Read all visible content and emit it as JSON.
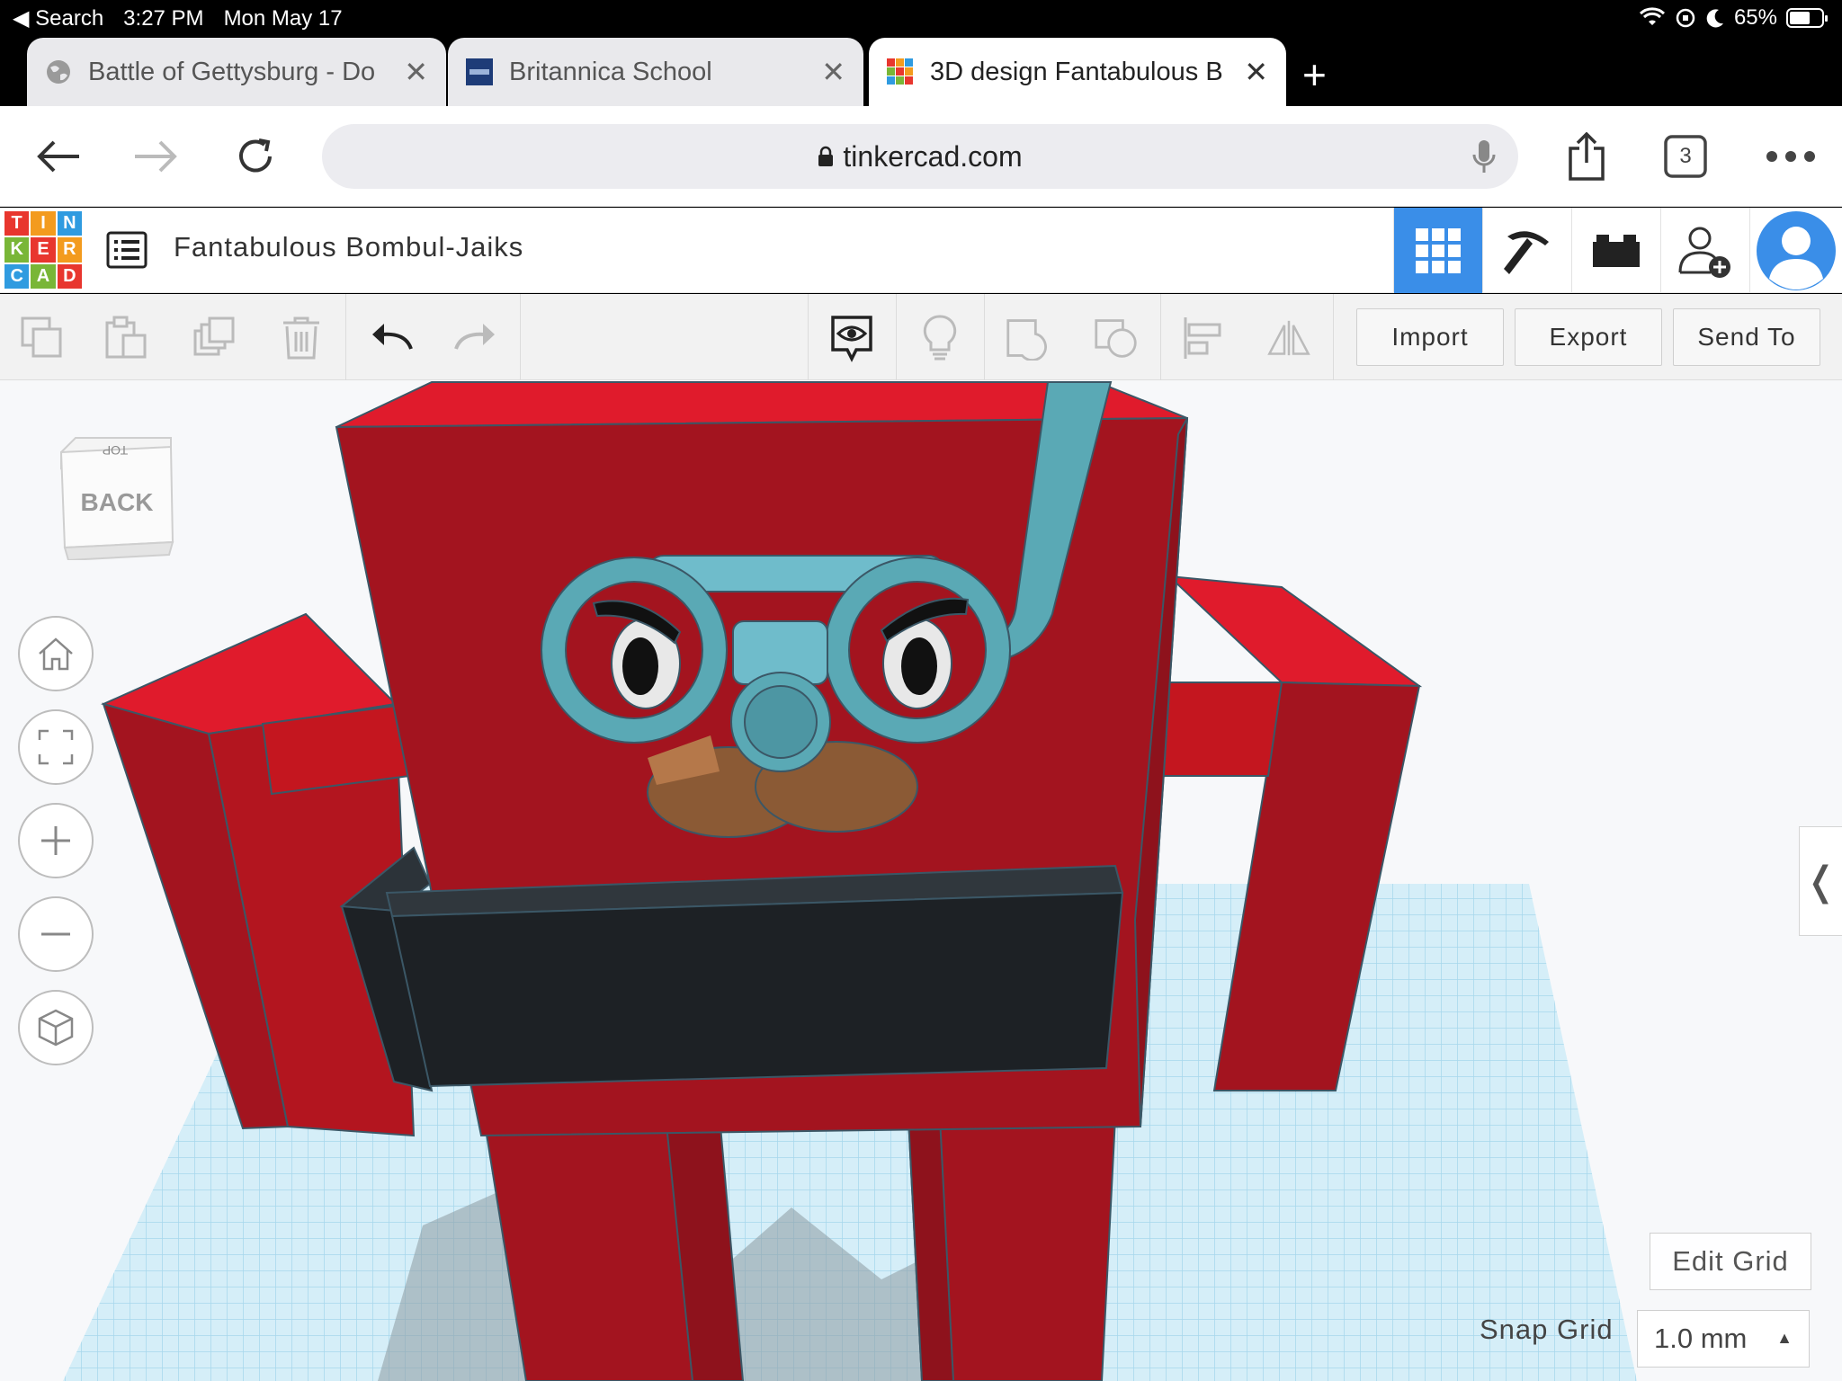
{
  "status_bar": {
    "back_app": "Search",
    "time": "3:27 PM",
    "date": "Mon May 17",
    "battery": "65%",
    "battery_level": 0.65
  },
  "browser": {
    "tabs": [
      {
        "title": "Battle of Gettysburg - Do",
        "active": false
      },
      {
        "title": "Britannica School",
        "active": false
      },
      {
        "title": "3D design Fantabulous B",
        "active": true
      }
    ],
    "url": "tinkercad.com",
    "tab_count": "3"
  },
  "tinkercad": {
    "logo_letters": [
      "T",
      "I",
      "N",
      "K",
      "E",
      "R",
      "C",
      "A",
      "D"
    ],
    "logo_colors": [
      "#e8362e",
      "#f39b1e",
      "#2f9be0",
      "#79b637",
      "#e8362e",
      "#f39b1e",
      "#2f9be0",
      "#79b637",
      "#e8362e"
    ],
    "design_name": "Fantabulous Bombul-Jaiks",
    "toolbar": {
      "import_label": "Import",
      "export_label": "Export",
      "send_to_label": "Send To"
    },
    "viewcube": {
      "top_label": "TOP",
      "front_label": "BACK"
    },
    "edit_grid_label": "Edit Grid",
    "snap_grid_label": "Snap Grid",
    "snap_grid_value": "1.0 mm"
  },
  "colors": {
    "accent": "#3a8ee8",
    "robot_red": "#a3141f",
    "robot_red_light": "#e01b2c",
    "goggles": "#5aa9b5",
    "belt": "#1d2125",
    "mustache": "#8b5a35",
    "grid": "#a9d9ee"
  }
}
